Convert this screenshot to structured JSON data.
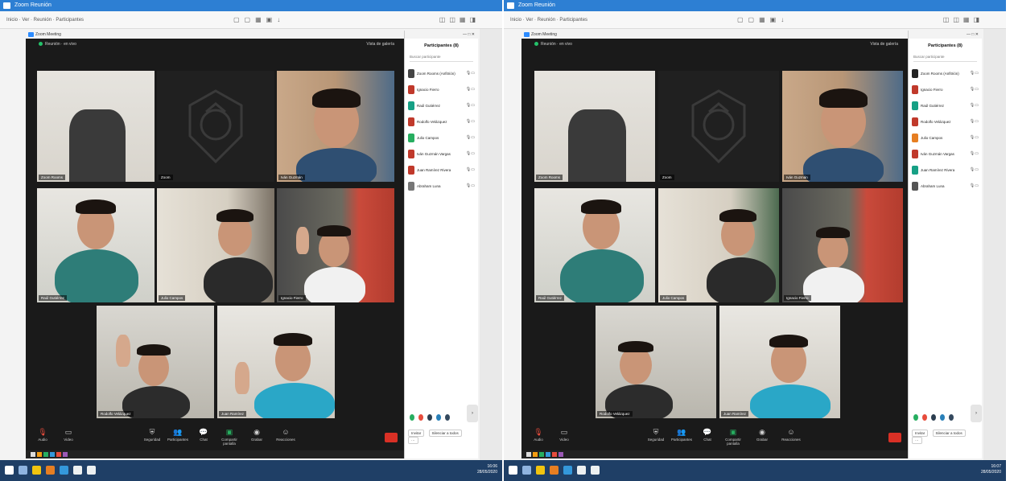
{
  "screens": [
    {
      "outer_window_title": "Zoom Reunión",
      "menu_text": "Inicio  ·  Ver  ·  Reunión  ·  Participantes",
      "zoom_window_title": "Zoom Meeting",
      "meeting_info": "Reunión · en vivo",
      "view_label": "Vista de galería",
      "participants_title": "Participantes (8)",
      "participants_search": "Buscar participante",
      "participants": [
        {
          "name": "Zoom Rooms (Anfitrión)",
          "color": "#444444"
        },
        {
          "name": "Ignacio Fierro",
          "color": "#c0392b"
        },
        {
          "name": "Raúl Gutiérrez",
          "color": "#16a085"
        },
        {
          "name": "Rodolfo Velázquez",
          "color": "#c0392b"
        },
        {
          "name": "Julio Campos",
          "color": "#27ae60"
        },
        {
          "name": "Iván Guzmán Vargas",
          "color": "#c0392b"
        },
        {
          "name": "Juan Ramírez Rivera",
          "color": "#c0392b"
        },
        {
          "name": "Abraham Luna",
          "color": "#777777"
        }
      ],
      "tiles": [
        {
          "name": "Zoom Rooms"
        },
        {
          "name": "Zoom"
        },
        {
          "name": "Iván Guzmán"
        },
        {
          "name": "Raúl Gutiérrez"
        },
        {
          "name": "Julio Campos"
        },
        {
          "name": "Ignacio Fierro"
        },
        {
          "name": "Rodolfo Velázquez"
        },
        {
          "name": "Juan Ramírez"
        }
      ],
      "toolbar": [
        "Audio",
        "Video",
        "Seguridad",
        "Participantes",
        "Chat",
        "Compartir pantalla",
        "Grabar",
        "Reacciones"
      ],
      "footer_buttons": [
        "Invitar",
        "Silenciar a todos",
        "···"
      ],
      "clock": "16:06\n28/05/2020"
    },
    {
      "outer_window_title": "Zoom Reunión",
      "menu_text": "Inicio  ·  Ver  ·  Reunión  ·  Participantes",
      "zoom_window_title": "Zoom Meeting",
      "meeting_info": "Reunión · en vivo",
      "view_label": "Vista de galería",
      "participants_title": "Participantes (8)",
      "participants_search": "Buscar participante",
      "participants": [
        {
          "name": "Zoom Rooms (Anfitrión)",
          "color": "#222222"
        },
        {
          "name": "Ignacio Fierro",
          "color": "#c0392b"
        },
        {
          "name": "Raúl Gutiérrez",
          "color": "#16a085"
        },
        {
          "name": "Rodolfo Velázquez",
          "color": "#c0392b"
        },
        {
          "name": "Julio Campos",
          "color": "#e67e22"
        },
        {
          "name": "Iván Guzmán Vargas",
          "color": "#c0392b"
        },
        {
          "name": "Juan Ramírez Rivera",
          "color": "#16a085"
        },
        {
          "name": "Abraham Luna",
          "color": "#555555"
        }
      ],
      "tiles": [
        {
          "name": "Zoom Rooms"
        },
        {
          "name": "Zoom"
        },
        {
          "name": "Iván Guzmán"
        },
        {
          "name": "Raúl Gutiérrez"
        },
        {
          "name": "Julio Campos"
        },
        {
          "name": "Ignacio Fierro"
        },
        {
          "name": "Rodolfo Velázquez"
        },
        {
          "name": "Juan Ramírez"
        }
      ],
      "toolbar": [
        "Audio",
        "Video",
        "Seguridad",
        "Participantes",
        "Chat",
        "Compartir pantalla",
        "Grabar",
        "Reacciones"
      ],
      "footer_buttons": [
        "Invitar",
        "Silenciar a todos",
        "···"
      ],
      "clock": "16:07\n28/05/2020"
    }
  ],
  "colors": {
    "zoom_bg": "#1a1a1a",
    "active_speaker": "#b8d33a",
    "end_button": "#d93025",
    "taskbar": "#1f3f66",
    "titlebar": "#2d7fd3"
  },
  "icons": [
    "microphone-icon",
    "video-camera-icon",
    "shield-icon",
    "people-icon",
    "chat-icon",
    "share-screen-icon",
    "record-icon",
    "reaction-icon",
    "windows-start-icon",
    "search-icon"
  ]
}
